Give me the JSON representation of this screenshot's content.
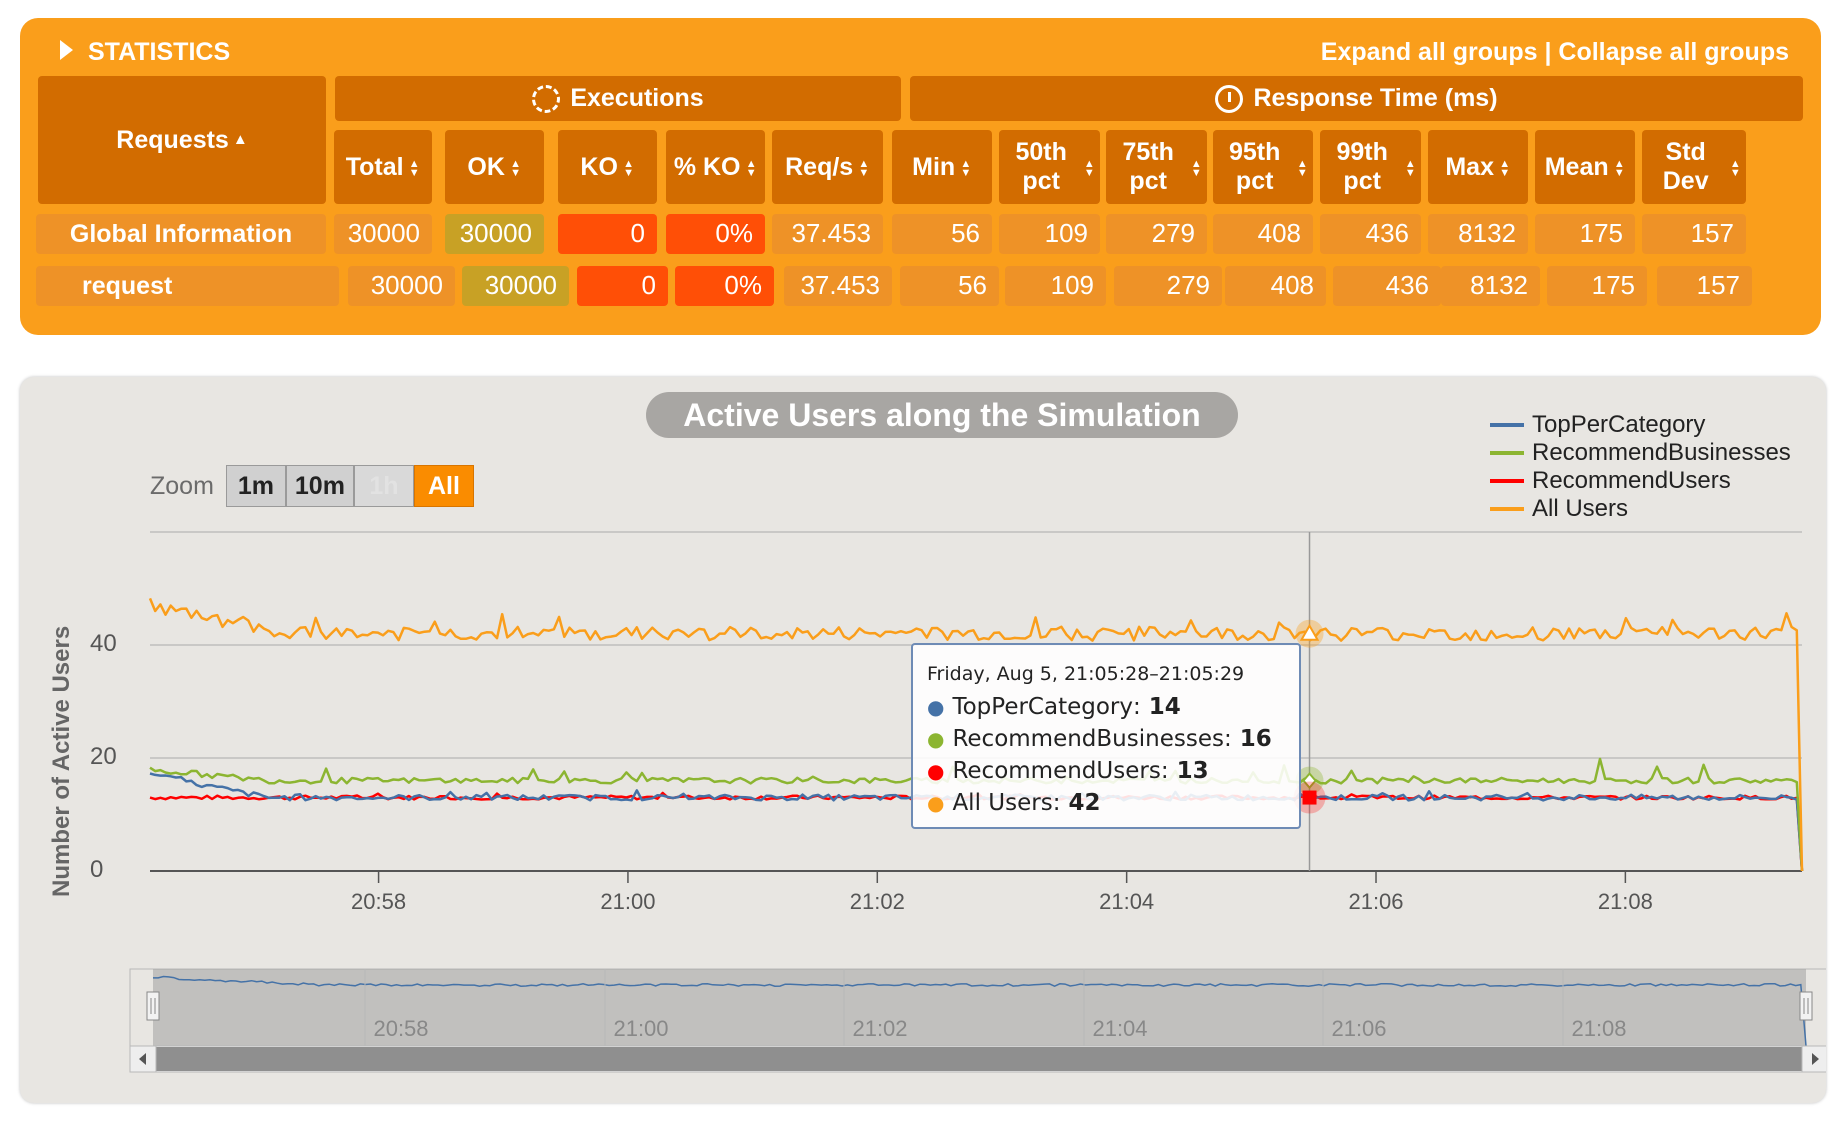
{
  "stats": {
    "title": "STATISTICS",
    "expand_label": "Expand all groups",
    "separator": " | ",
    "collapse_label": "Collapse all groups",
    "requests_header": "Requests",
    "executions_header": "Executions",
    "response_time_header": "Response Time (ms)",
    "columns": [
      "Total",
      "OK",
      "KO",
      "% KO",
      "Req/s",
      "Min",
      "50th pct",
      "75th pct",
      "95th pct",
      "99th pct",
      "Max",
      "Mean",
      "Std Dev"
    ],
    "rows": [
      {
        "name": "Global Information",
        "values": [
          "30000",
          "30000",
          "0",
          "0%",
          "37.453",
          "56",
          "109",
          "279",
          "408",
          "436",
          "8132",
          "175",
          "157"
        ]
      },
      {
        "name": "request",
        "values": [
          "30000",
          "30000",
          "0",
          "0%",
          "37.453",
          "56",
          "109",
          "279",
          "408",
          "436",
          "8132",
          "175",
          "157"
        ]
      }
    ]
  },
  "chart": {
    "title": "Active Users along the Simulation",
    "zoom_label": "Zoom",
    "zoom_buttons": [
      "1m",
      "10m",
      "1h",
      "All"
    ],
    "zoom_selected": "All",
    "y_axis_title": "Number of Active Users",
    "y_ticks": [
      "40",
      "20",
      "0"
    ],
    "x_ticks": [
      "20:58",
      "21:00",
      "21:02",
      "21:04",
      "21:06",
      "21:08"
    ],
    "navigator_ticks": [
      "20:58",
      "21:00",
      "21:02",
      "21:04",
      "21:06",
      "21:08"
    ],
    "legend": [
      {
        "name": "TopPerCategory",
        "color": "#4572a7"
      },
      {
        "name": "RecommendBusinesses",
        "color": "#8cb531"
      },
      {
        "name": "RecommendUsers",
        "color": "#ff0000"
      },
      {
        "name": "All Users",
        "color": "#fa9e1b"
      }
    ],
    "tooltip": {
      "title": "Friday, Aug 5, 21:05:28–21:05:29",
      "items": [
        {
          "name": "TopPerCategory",
          "value": "14",
          "color": "#4572a7"
        },
        {
          "name": "RecommendBusinesses",
          "value": "16",
          "color": "#8cb531"
        },
        {
          "name": "RecommendUsers",
          "value": "13",
          "color": "#ff0000"
        },
        {
          "name": "All Users",
          "value": "42",
          "color": "#fa9e1b"
        }
      ]
    }
  },
  "chart_data": {
    "type": "line",
    "title": "Active Users along the Simulation",
    "ylabel": "Number of Active Users",
    "xlabel": "",
    "x_range": [
      "20:56:10",
      "21:09:25"
    ],
    "ylim": [
      0,
      60
    ],
    "grid": true,
    "legend_position": "top-right",
    "series": [
      {
        "name": "TopPerCategory",
        "color": "#4572a7",
        "typical": 13,
        "start": 17,
        "end": 0
      },
      {
        "name": "RecommendBusinesses",
        "color": "#8cb531",
        "typical": 16,
        "start": 18,
        "end": 0
      },
      {
        "name": "RecommendUsers",
        "color": "#ff0000",
        "typical": 13,
        "start": 13,
        "end": 0
      },
      {
        "name": "All Users",
        "color": "#fa9e1b",
        "typical": 42,
        "start": 47,
        "end": 0
      }
    ],
    "highlight": {
      "time": "21:05:28",
      "TopPerCategory": 14,
      "RecommendBusinesses": 16,
      "RecommendUsers": 13,
      "All Users": 42
    }
  }
}
